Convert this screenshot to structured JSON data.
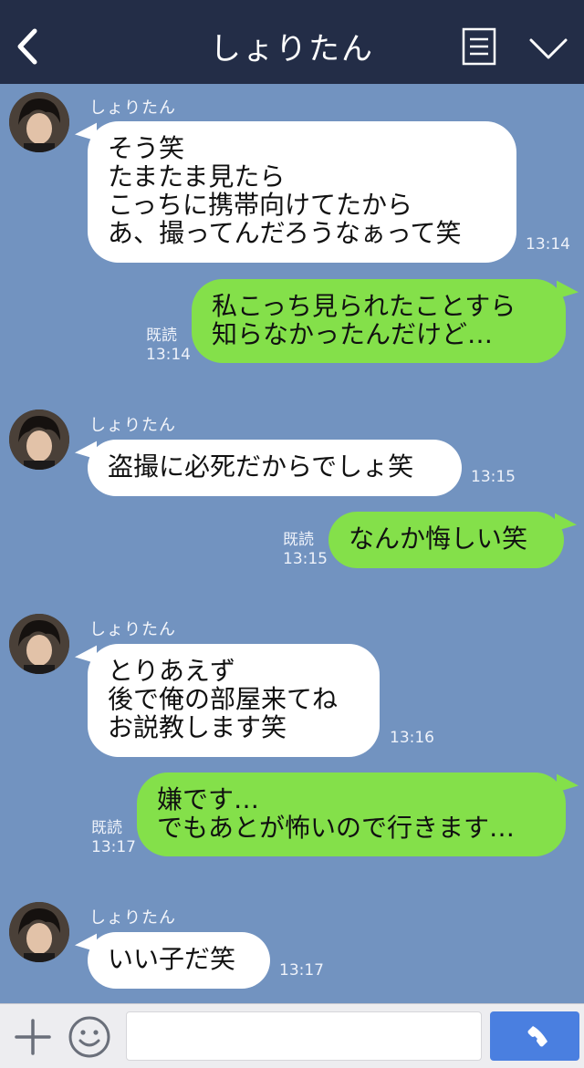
{
  "header": {
    "title": "しょりたん"
  },
  "messages": [
    {
      "sender": "しょりたん",
      "text": "そう笑\nたまたま見たら\nこっちに携帯向けてたから\nあ、撮ってんだろうなぁって笑",
      "time": "13:14"
    },
    {
      "text": "私こっち見られたことすら\n知らなかったんだけど…",
      "read": "既読",
      "time": "13:14"
    },
    {
      "sender": "しょりたん",
      "text": "盗撮に必死だからでしょ笑",
      "time": "13:15"
    },
    {
      "text": "なんか悔しい笑",
      "read": "既読",
      "time": "13:15"
    },
    {
      "sender": "しょりたん",
      "text": "とりあえず\n後で俺の部屋来てね\nお説教します笑",
      "time": "13:16"
    },
    {
      "text": "嫌です…\nでもあとが怖いので行きます…",
      "read": "既読",
      "time": "13:17"
    },
    {
      "sender": "しょりたん",
      "text": "いい子だ笑",
      "time": "13:17"
    }
  ],
  "input": {
    "value": "",
    "placeholder": ""
  },
  "icons": {
    "back": "chevron-left-icon",
    "menu": "menu-list-icon",
    "expand": "chevron-down-icon",
    "add": "plus-icon",
    "emoji": "smile-icon",
    "call": "phone-icon"
  },
  "colors": {
    "header": "#232d47",
    "background": "#7293c0",
    "incoming_bubble": "#ffffff",
    "outgoing_bubble": "#84e04a",
    "call_button": "#4a7fe0"
  }
}
